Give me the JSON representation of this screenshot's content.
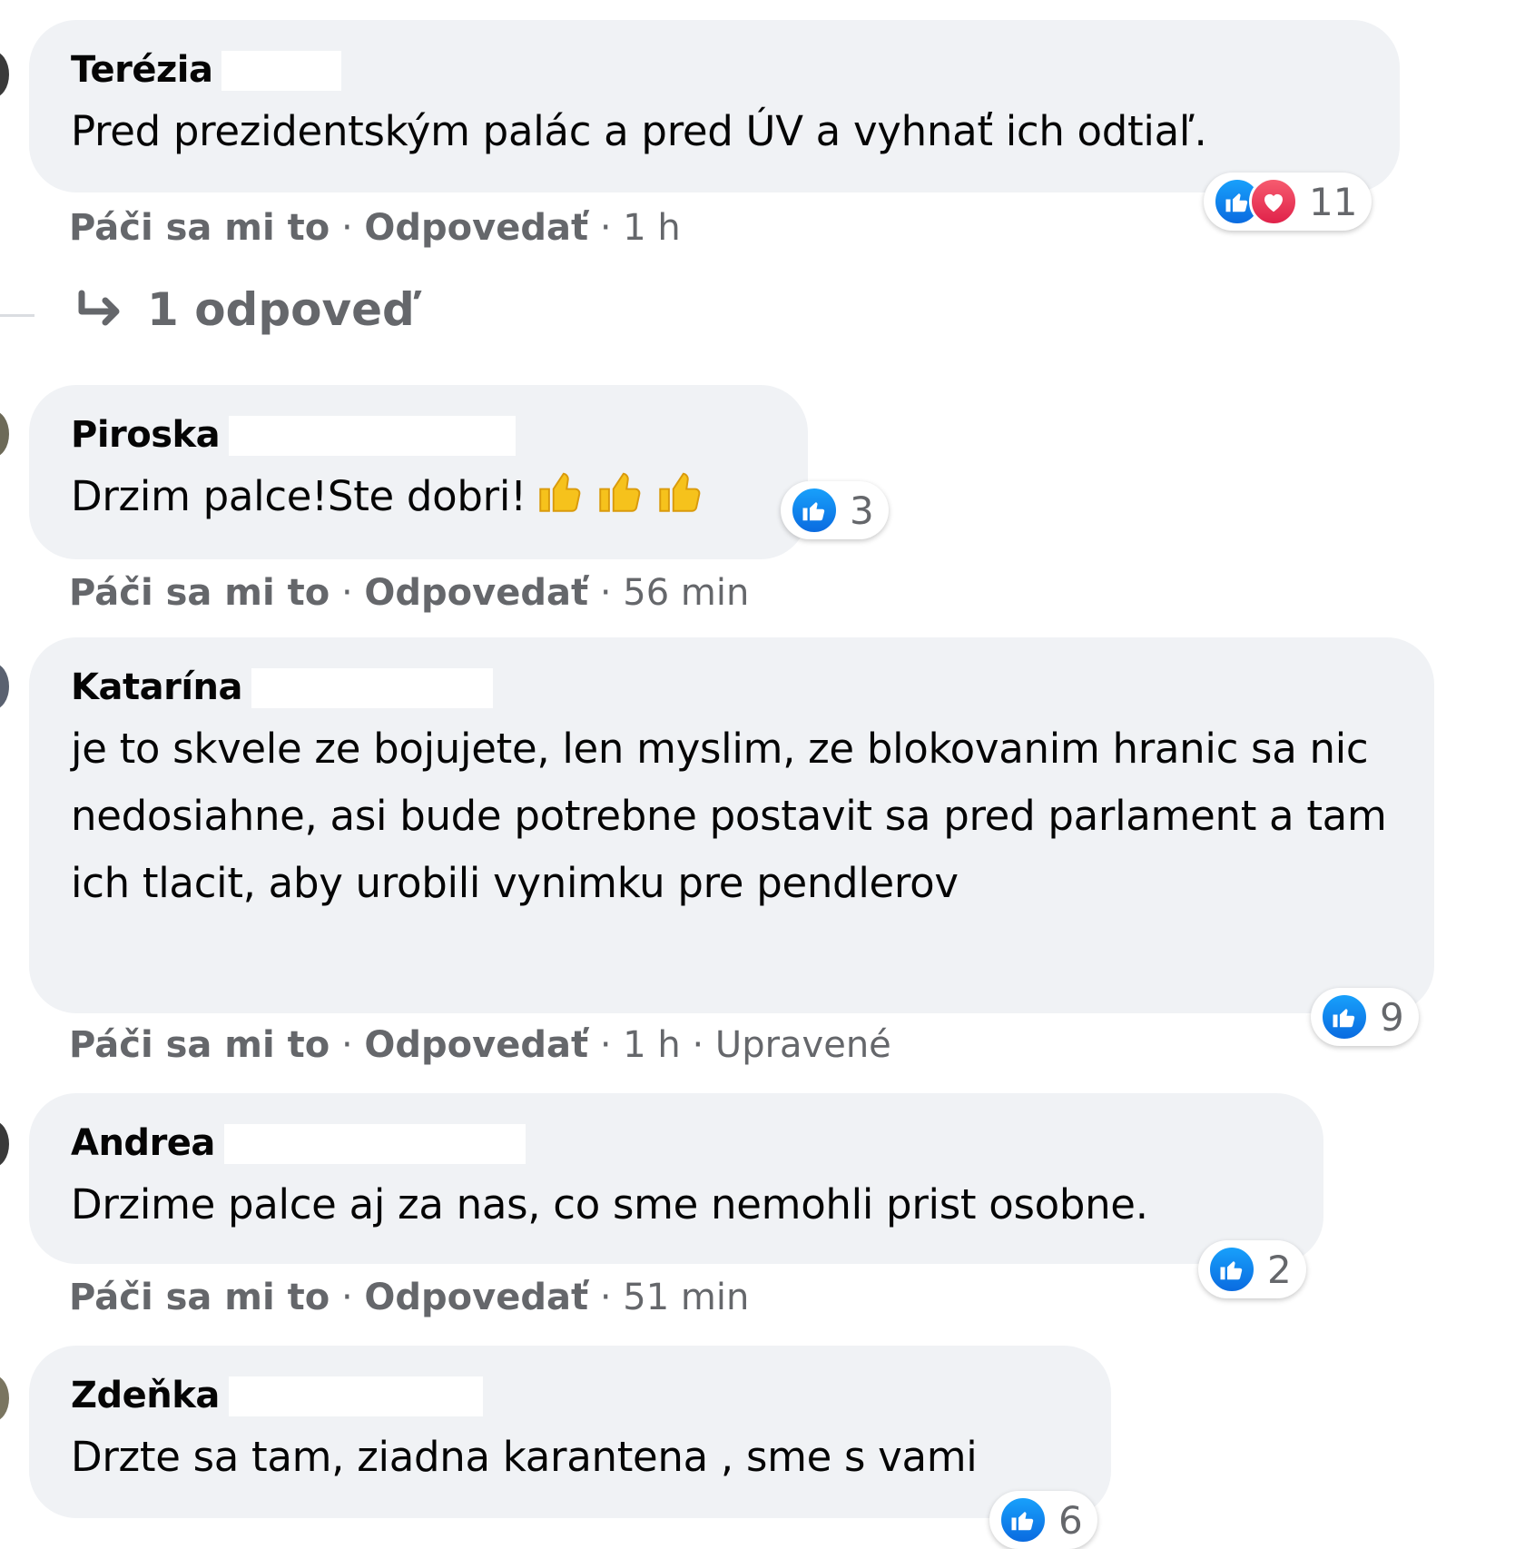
{
  "comments": [
    {
      "author": "Terézia",
      "text": "Pred prezidentským palác a pred ÚV a vyhnať ich odtiaľ.",
      "reactions": [
        "like",
        "love"
      ],
      "reaction_count": "11",
      "like_label": "Páči sa mi to",
      "reply_label": "Odpovedať",
      "time": "1 h",
      "replies_label": "1 odpoveď"
    },
    {
      "author": "Piroska",
      "text": "Drzim palce!Ste dobri!",
      "emoji": [
        "thumbs-up",
        "thumbs-up",
        "thumbs-up"
      ],
      "reactions": [
        "like"
      ],
      "reaction_count": "3",
      "like_label": "Páči sa mi to",
      "reply_label": "Odpovedať",
      "time": "56 min"
    },
    {
      "author": "Katarína",
      "text": "je to skvele ze bojujete, len myslim, ze blokovanim hranic sa nic nedosiahne, asi bude potrebne postavit sa pred parlament a tam ich tlacit, aby urobili vynimku pre pendlerov",
      "reactions": [
        "like"
      ],
      "reaction_count": "9",
      "like_label": "Páči sa mi to",
      "reply_label": "Odpovedať",
      "time": "1 h",
      "edited_label": "Upravené"
    },
    {
      "author": "Andrea",
      "text": "Drzime palce aj za nas, co sme nemohli prist osobne.",
      "reactions": [
        "like"
      ],
      "reaction_count": "2",
      "like_label": "Páči sa mi to",
      "reply_label": "Odpovedať",
      "time": "51 min"
    },
    {
      "author": "Zdeňka",
      "text": "Drzte sa tam, ziadna karantena , sme s vami",
      "reactions": [
        "like"
      ],
      "reaction_count": "6"
    }
  ],
  "separator": "·",
  "colors": {
    "bubble": "#f0f2f5",
    "secondary_text": "#65676b",
    "like_blue": "#0a6be0",
    "love_red": "#e0224a"
  }
}
